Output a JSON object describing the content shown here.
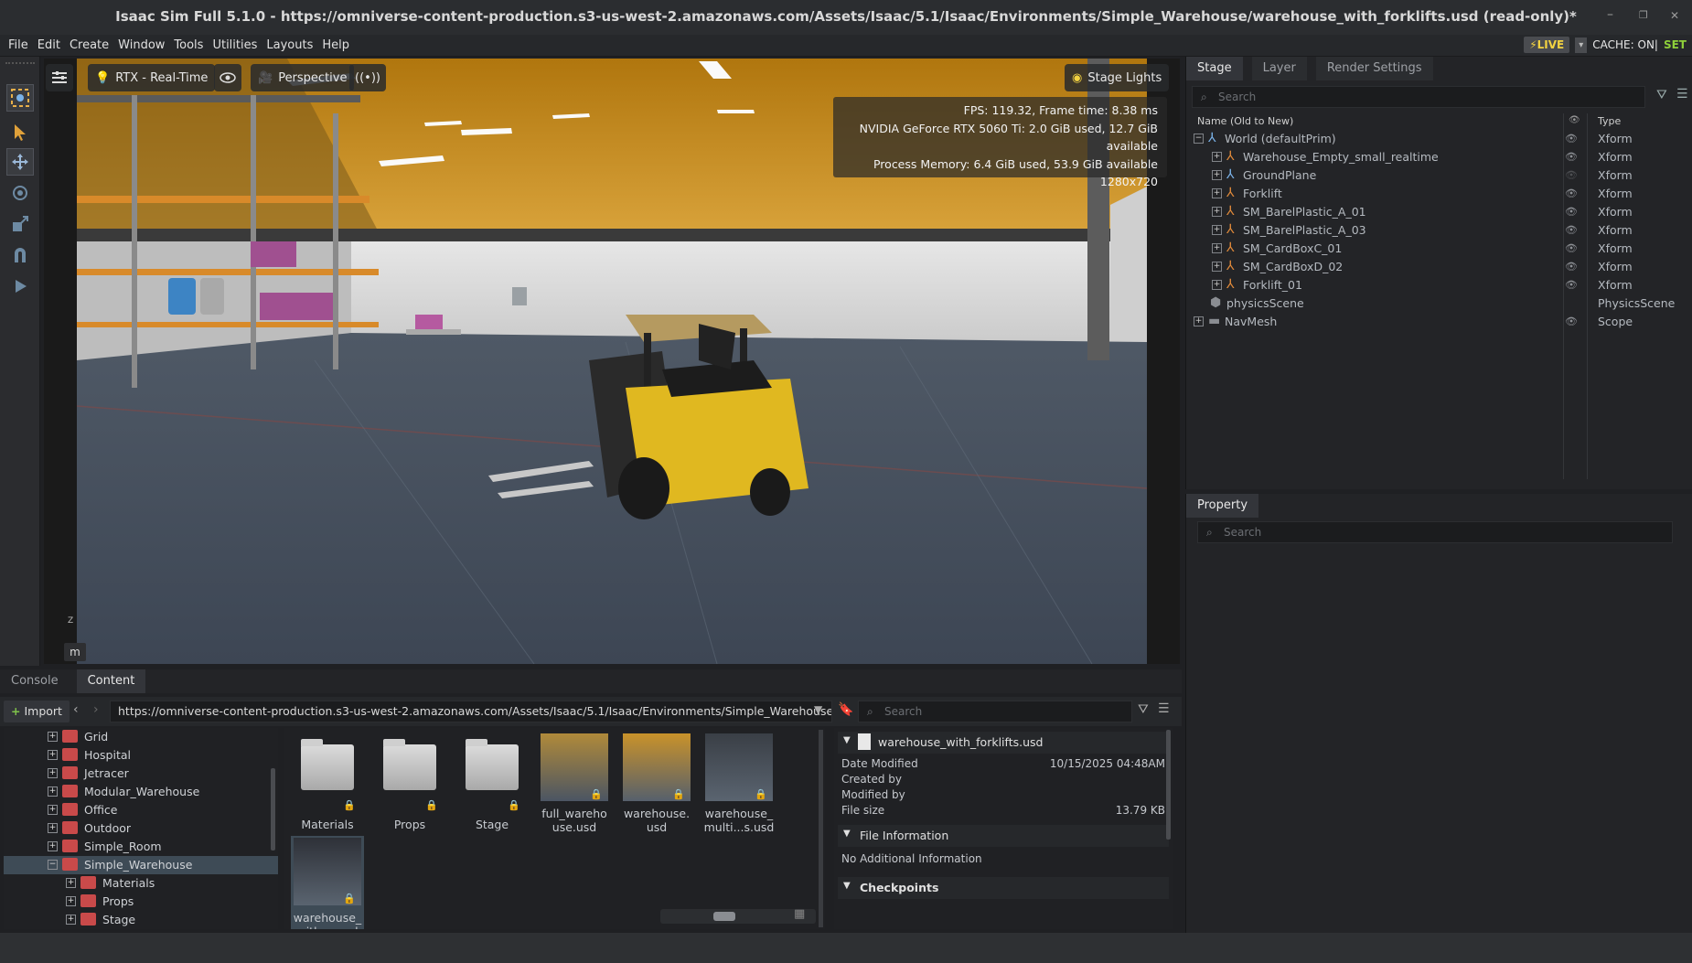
{
  "window": {
    "title": "Isaac Sim Full 5.1.0 - https://omniverse-content-production.s3-us-west-2.amazonaws.com/Assets/Isaac/5.1/Isaac/Environments/Simple_Warehouse/warehouse_with_forklifts.usd (read-only)*",
    "minimize": "–",
    "restore": "❐",
    "close": "✕"
  },
  "menu": [
    "File",
    "Edit",
    "Create",
    "Window",
    "Tools",
    "Utilities",
    "Layouts",
    "Help"
  ],
  "status": {
    "live_label": "LIVE",
    "live_dropdown": "▾",
    "cache_label": "CACHE: ON|",
    "set_label": "SET"
  },
  "viewport": {
    "renderer_label": "RTX - Real-Time",
    "camera_label": "Perspective",
    "lights_label": "Stage Lights",
    "stats": [
      "FPS: 119.32, Frame time: 8.38 ms",
      "NVIDIA GeForce RTX 5060 Ti: 2.0 GiB used, 12.7 GiB available",
      "Process Memory: 6.4 GiB used, 53.9 GiB available",
      "1280x720"
    ],
    "nav_key": "m",
    "axis_z": "Z"
  },
  "stage": {
    "tabs": [
      "Stage",
      "Layer",
      "Render Settings"
    ],
    "search_placeholder": "Search",
    "col_name": "Name (Old to New)",
    "col_type": "Type",
    "rows": [
      {
        "name": "World (defaultPrim)",
        "type": "Xform",
        "depth": 0,
        "expand": "−",
        "icon": "xform-icon",
        "visible": true
      },
      {
        "name": "Warehouse_Empty_small_realtime",
        "type": "Xform",
        "depth": 1,
        "expand": "+",
        "icon": "asset-icon",
        "visible": true
      },
      {
        "name": "GroundPlane",
        "type": "Xform",
        "depth": 1,
        "expand": "+",
        "icon": "xform-icon",
        "visible": false
      },
      {
        "name": "Forklift",
        "type": "Xform",
        "depth": 1,
        "expand": "+",
        "icon": "asset-icon",
        "visible": true
      },
      {
        "name": "SM_BarelPlastic_A_01",
        "type": "Xform",
        "depth": 1,
        "expand": "+",
        "icon": "asset-icon",
        "visible": true
      },
      {
        "name": "SM_BarelPlastic_A_03",
        "type": "Xform",
        "depth": 1,
        "expand": "+",
        "icon": "asset-icon",
        "visible": true
      },
      {
        "name": "SM_CardBoxC_01",
        "type": "Xform",
        "depth": 1,
        "expand": "+",
        "icon": "asset-icon",
        "visible": true
      },
      {
        "name": "SM_CardBoxD_02",
        "type": "Xform",
        "depth": 1,
        "expand": "+",
        "icon": "asset-icon",
        "visible": true
      },
      {
        "name": "Forklift_01",
        "type": "Xform",
        "depth": 1,
        "expand": "+",
        "icon": "asset-icon",
        "visible": true
      },
      {
        "name": "physicsScene",
        "type": "PhysicsScene",
        "depth": 1,
        "expand": "",
        "icon": "physics-icon",
        "visible": null
      },
      {
        "name": "NavMesh",
        "type": "Scope",
        "depth": 0,
        "expand": "+",
        "icon": "folder-icon",
        "visible": true
      }
    ]
  },
  "property": {
    "tab": "Property",
    "search_placeholder": "Search"
  },
  "bottom": {
    "tabs": [
      "Console",
      "Content"
    ],
    "import_label": "Import",
    "path": "https://omniverse-content-production.s3-us-west-2.amazonaws.com/Assets/Isaac/5.1/Isaac/Environments/Simple_Warehouse/",
    "search_placeholder": "Search",
    "tree": [
      {
        "name": "Grid",
        "depth": 0,
        "expand": "+",
        "selected": false
      },
      {
        "name": "Hospital",
        "depth": 0,
        "expand": "+",
        "selected": false
      },
      {
        "name": "Jetracer",
        "depth": 0,
        "expand": "+",
        "selected": false
      },
      {
        "name": "Modular_Warehouse",
        "depth": 0,
        "expand": "+",
        "selected": false
      },
      {
        "name": "Office",
        "depth": 0,
        "expand": "+",
        "selected": false
      },
      {
        "name": "Outdoor",
        "depth": 0,
        "expand": "+",
        "selected": false
      },
      {
        "name": "Simple_Room",
        "depth": 0,
        "expand": "+",
        "selected": false
      },
      {
        "name": "Simple_Warehouse",
        "depth": 0,
        "expand": "−",
        "selected": true
      },
      {
        "name": "Materials",
        "depth": 1,
        "expand": "+",
        "selected": false
      },
      {
        "name": "Props",
        "depth": 1,
        "expand": "+",
        "selected": false
      },
      {
        "name": "Stage",
        "depth": 1,
        "expand": "+",
        "selected": false
      }
    ],
    "grid": [
      {
        "label": "Materials",
        "kind": "folder"
      },
      {
        "label": "Props",
        "kind": "folder"
      },
      {
        "label": "Stage",
        "kind": "folder"
      },
      {
        "label": "full_wareho use.usd",
        "kind": "thumb"
      },
      {
        "label": "warehouse. usd",
        "kind": "thumb"
      },
      {
        "label": "warehouse_ multi...s.usd",
        "kind": "thumb"
      },
      {
        "label": "warehouse_ with_...usd",
        "kind": "thumb"
      }
    ],
    "info": {
      "file_name": "warehouse_with_forklifts.usd",
      "date_modified_label": "Date Modified",
      "date_modified": "10/15/2025 04:48AM",
      "created_by_label": "Created by",
      "modified_by_label": "Modified by",
      "file_size_label": "File size",
      "file_size": "13.79 KB",
      "file_info_header": "File Information",
      "no_info": "No Additional Information",
      "checkpoints_header": "Checkpoints"
    }
  },
  "colors": {
    "accent_live": "#f2d241",
    "set_green": "#8ecf3a",
    "folder_red": "#c94a4a",
    "selection": "#3e4b56"
  }
}
